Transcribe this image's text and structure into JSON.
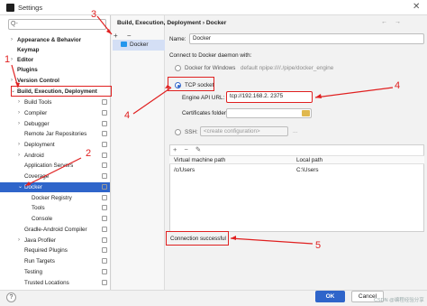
{
  "window": {
    "title": "Settings",
    "close_glyph": "✕"
  },
  "search": {
    "placeholder": "Q-",
    "icon": "search-icon"
  },
  "tree": [
    {
      "label": "Appearance & Behavior",
      "bold": true,
      "arrow": "›"
    },
    {
      "label": "Keymap",
      "bold": true,
      "arrow": ""
    },
    {
      "label": "Editor",
      "bold": true,
      "arrow": "›"
    },
    {
      "label": "Plugins",
      "bold": true,
      "arrow": ""
    },
    {
      "label": "Version Control",
      "bold": true,
      "arrow": "›"
    },
    {
      "label": "Build, Execution, Deployment",
      "bold": true,
      "arrow": "⌄"
    },
    {
      "label": "Build Tools",
      "bold": false,
      "arrow": "›"
    },
    {
      "label": "Compiler",
      "bold": false,
      "arrow": "›"
    },
    {
      "label": "Debugger",
      "bold": false,
      "arrow": "›"
    },
    {
      "label": "Remote Jar Repositories",
      "bold": false,
      "arrow": ""
    },
    {
      "label": "Deployment",
      "bold": false,
      "arrow": "›"
    },
    {
      "label": "Android",
      "bold": false,
      "arrow": "›"
    },
    {
      "label": "Application Servers",
      "bold": false,
      "arrow": ""
    },
    {
      "label": "Coverage",
      "bold": false,
      "arrow": ""
    },
    {
      "label": "Docker",
      "bold": false,
      "arrow": "⌄",
      "selected": true
    },
    {
      "label": "Docker Registry",
      "bold": false,
      "arrow": ""
    },
    {
      "label": "Tools",
      "bold": false,
      "arrow": ""
    },
    {
      "label": "Console",
      "bold": false,
      "arrow": ""
    },
    {
      "label": "Gradle-Android Compiler",
      "bold": false,
      "arrow": ""
    },
    {
      "label": "Java Profiler",
      "bold": false,
      "arrow": "›"
    },
    {
      "label": "Required Plugins",
      "bold": false,
      "arrow": ""
    },
    {
      "label": "Run Targets",
      "bold": false,
      "arrow": ""
    },
    {
      "label": "Testing",
      "bold": false,
      "arrow": ""
    },
    {
      "label": "Trusted Locations",
      "bold": false,
      "arrow": ""
    }
  ],
  "breadcrumb": "Build, Execution, Deployment  ›  Docker",
  "nav_arrows": "← →",
  "mid_toolbar": "+ −",
  "docker_list": {
    "item": "Docker"
  },
  "form": {
    "name_label": "Name:",
    "name_value": "Docker",
    "connect_label": "Connect to Docker daemon with:",
    "opt_windows": "Docker for Windows",
    "opt_windows_hint": "default  npipe:////./pipe/docker_engine",
    "opt_tcp": "TCP socket",
    "api_label": "Engine API URL:",
    "api_value": "tcp://192.168.2.    2375",
    "cert_label": "Certificates folder:",
    "opt_ssh": "SSH:",
    "ssh_placeholder": "<create configuration>",
    "ssh_link": "..."
  },
  "volumes": {
    "tools": "+ − ✎",
    "col_vm": "Virtual machine path",
    "col_local": "Local path",
    "rows": [
      {
        "vm": "/c/Users",
        "local": "C:\\Users"
      }
    ]
  },
  "status": "Connection successful",
  "buttons": {
    "ok": "OK",
    "cancel": "Cancel",
    "help": "?"
  },
  "watermark": "CSDN @编程经验分享",
  "annotations": [
    "1",
    "2",
    "3",
    "4",
    "4",
    "5"
  ],
  "colors": {
    "accent": "#2f65ca",
    "annotation": "#e02020"
  }
}
